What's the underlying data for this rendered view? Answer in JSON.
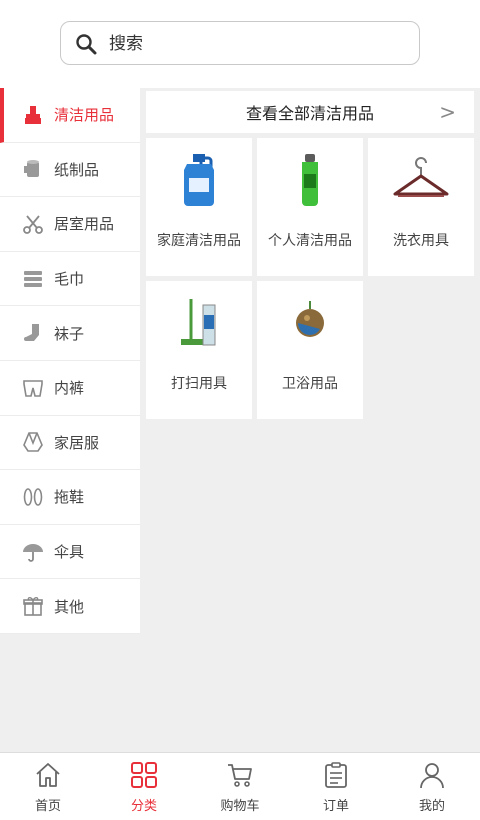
{
  "search": {
    "placeholder": "搜索",
    "icon": "search-icon"
  },
  "sidebar": {
    "items": [
      {
        "label": "清洁用品",
        "icon": "cleaning-icon",
        "active": true
      },
      {
        "label": "纸制品",
        "icon": "paper-roll-icon",
        "active": false
      },
      {
        "label": "居室用品",
        "icon": "scissors-icon",
        "active": false
      },
      {
        "label": "毛巾",
        "icon": "towel-icon",
        "active": false
      },
      {
        "label": "袜子",
        "icon": "sock-icon",
        "active": false
      },
      {
        "label": "内裤",
        "icon": "underwear-icon",
        "active": false
      },
      {
        "label": "家居服",
        "icon": "clothing-icon",
        "active": false
      },
      {
        "label": "拖鞋",
        "icon": "slippers-icon",
        "active": false
      },
      {
        "label": "伞具",
        "icon": "umbrella-icon",
        "active": false
      },
      {
        "label": "其他",
        "icon": "gift-icon",
        "active": false
      }
    ]
  },
  "content": {
    "view_all_label": "查看全部清洁用品",
    "view_all_arrow": ">",
    "categories": [
      {
        "label": "家庭清洁用品",
        "image": "detergent-bottle"
      },
      {
        "label": "个人清洁用品",
        "image": "shampoo-bottle"
      },
      {
        "label": "洗衣用具",
        "image": "clothes-hanger"
      },
      {
        "label": "打扫用具",
        "image": "mop"
      },
      {
        "label": "卫浴用品",
        "image": "bath-sponge"
      }
    ]
  },
  "tabbar": {
    "items": [
      {
        "label": "首页",
        "icon": "home-icon",
        "active": false
      },
      {
        "label": "分类",
        "icon": "category-grid-icon",
        "active": true
      },
      {
        "label": "购物车",
        "icon": "cart-icon",
        "active": false
      },
      {
        "label": "订单",
        "icon": "order-clipboard-icon",
        "active": false
      },
      {
        "label": "我的",
        "icon": "user-icon",
        "active": false
      }
    ]
  },
  "colors": {
    "accent": "#e8303a",
    "background": "#efefef"
  }
}
